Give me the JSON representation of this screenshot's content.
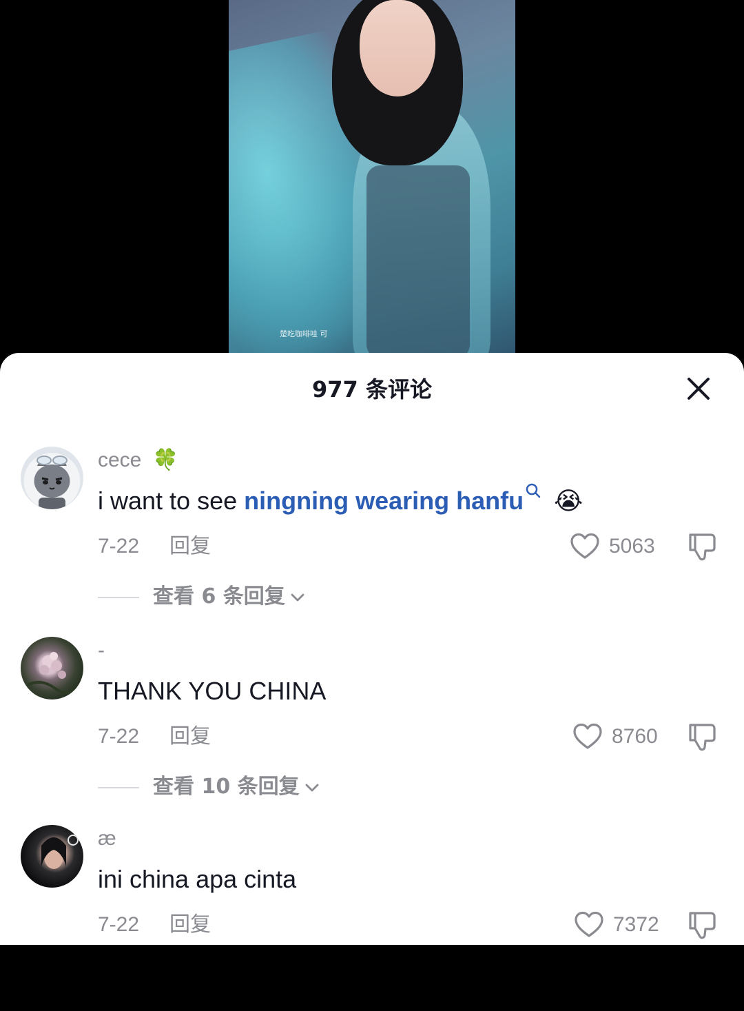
{
  "video": {
    "watermark": "楚吃咖啡哇 可"
  },
  "sheet": {
    "title": "977 条评论"
  },
  "comments": [
    {
      "username": "cece",
      "username_emoji": "🍀",
      "text_plain": "i want to see ",
      "text_link": "ningning wearing hanfu",
      "text_emoji": "😭",
      "date": "7-22",
      "reply_label": "回复",
      "likes": "5063",
      "view_replies": "查看 6 条回复"
    },
    {
      "username": "-",
      "text": "THANK YOU CHINA",
      "date": "7-22",
      "reply_label": "回复",
      "likes": "8760",
      "view_replies": "查看 10 条回复"
    },
    {
      "username": "æ",
      "text": "ini china apa cinta",
      "date": "7-22",
      "reply_label": "回复",
      "likes": "7372"
    }
  ],
  "colors": {
    "link": "#2b5db5",
    "text": "#161823",
    "muted": "#8a8b91"
  },
  "icons": [
    "close-icon",
    "heart-icon",
    "thumbs-down-icon",
    "search-icon",
    "chevron-down-icon"
  ]
}
